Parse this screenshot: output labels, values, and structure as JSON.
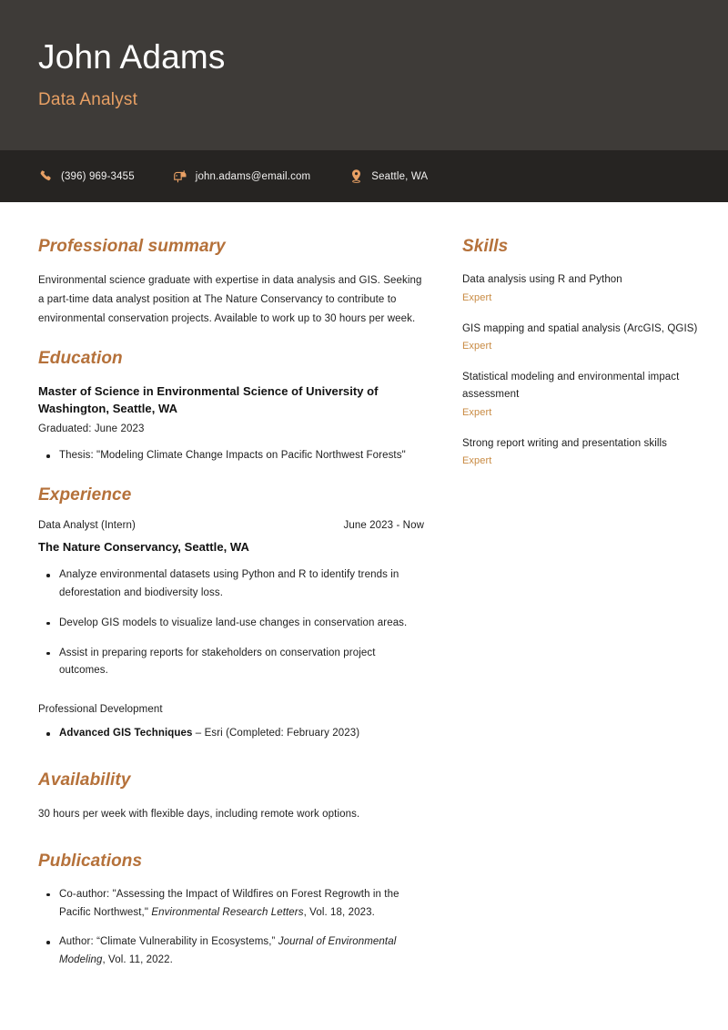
{
  "header": {
    "full_name": "John Adams",
    "job_title": "Data Analyst",
    "bg_color": "#3e3b38",
    "accent_color": "#e8a064"
  },
  "contact": {
    "phone": {
      "icon": "phone-icon",
      "text": "(396) 969-3455"
    },
    "email": {
      "icon": "mailbox-icon",
      "text": "john.adams@email.com"
    },
    "location": {
      "icon": "map-pin-icon",
      "text": "Seattle, WA"
    },
    "bg_color": "#262422"
  },
  "theme": {
    "heading_color": "#b5713a",
    "skill_level_color": "#c88a42",
    "text_color": "#1d1d1d"
  },
  "sections": {
    "summary": {
      "title": "Professional summary",
      "text": "Environmental science graduate with expertise in data analysis and GIS. Seeking a part-time data analyst position at The Nature Conservancy to contribute to environmental conservation projects. Available to work up to 30 hours per week."
    },
    "education": {
      "title": "Education",
      "degree": "Master of Science in Environmental Science of University of Washington, Seattle, WA",
      "graduated": "Graduated: June 2023",
      "bullets": [
        "Thesis: \"Modeling Climate Change Impacts on Pacific Northwest Forests\""
      ]
    },
    "experience": {
      "title": "Experience",
      "role": "Data Analyst (Intern)",
      "dates": "June 2023 - Now",
      "company": "The Nature Conservancy, Seattle, WA",
      "bullets": [
        "Analyze environmental datasets using Python and R to identify trends in deforestation and biodiversity loss.",
        "Develop GIS models to visualize land-use changes in conservation areas.",
        "Assist in preparing reports for stakeholders on conservation project outcomes."
      ],
      "professional_development": {
        "label": "Professional Development",
        "item_bold": "Advanced GIS Techniques",
        "item_rest": " – Esri (Completed: February 2023)"
      }
    },
    "availability": {
      "title": "Availability",
      "text": "30 hours per week with flexible days, including remote work options."
    },
    "publications": {
      "title": "Publications",
      "items": [
        {
          "prefix": "Co-author: \"Assessing the Impact of Wildfires on Forest Regrowth in the Pacific Northwest,\" ",
          "journal": "Environmental Research Letters",
          "suffix": ", Vol. 18, 2023."
        },
        {
          "prefix": "Author: “Climate Vulnerability in Ecosystems,” ",
          "journal": "Journal of Environmental Modeling",
          "suffix": ", Vol. 11, 2022."
        }
      ]
    },
    "skills": {
      "title": "Skills",
      "items": [
        {
          "name": "Data analysis using R and Python",
          "level": "Expert"
        },
        {
          "name": "GIS mapping and spatial analysis (ArcGIS, QGIS)",
          "level": "Expert"
        },
        {
          "name": "Statistical modeling and environmental impact assessment",
          "level": "Expert"
        },
        {
          "name": "Strong report writing and presentation skills",
          "level": "Expert"
        }
      ]
    }
  }
}
